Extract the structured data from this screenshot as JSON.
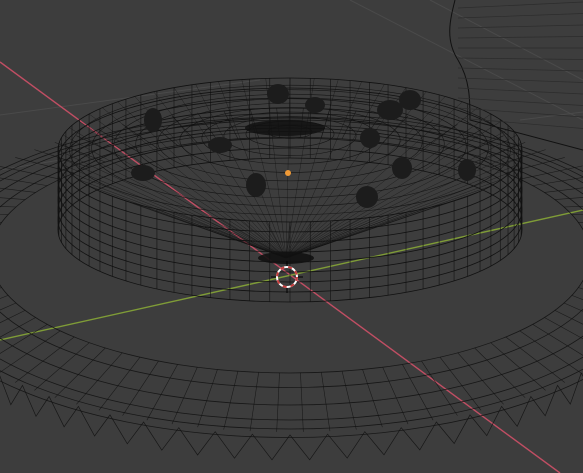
{
  "viewport": {
    "background": "#3d3d3d",
    "grid_color": "#4a4a4a",
    "x_axis_color": "#c04e63",
    "y_axis_color": "#7f9c37",
    "wire_color": "#111111",
    "lump_color": "#1c1c1c",
    "origin_color": "#f09a36",
    "cursor_colors": [
      "#c63d3d",
      "#ffffff"
    ]
  },
  "icons": {
    "origin": "object-origin-dot",
    "cursor": "3d-cursor"
  }
}
